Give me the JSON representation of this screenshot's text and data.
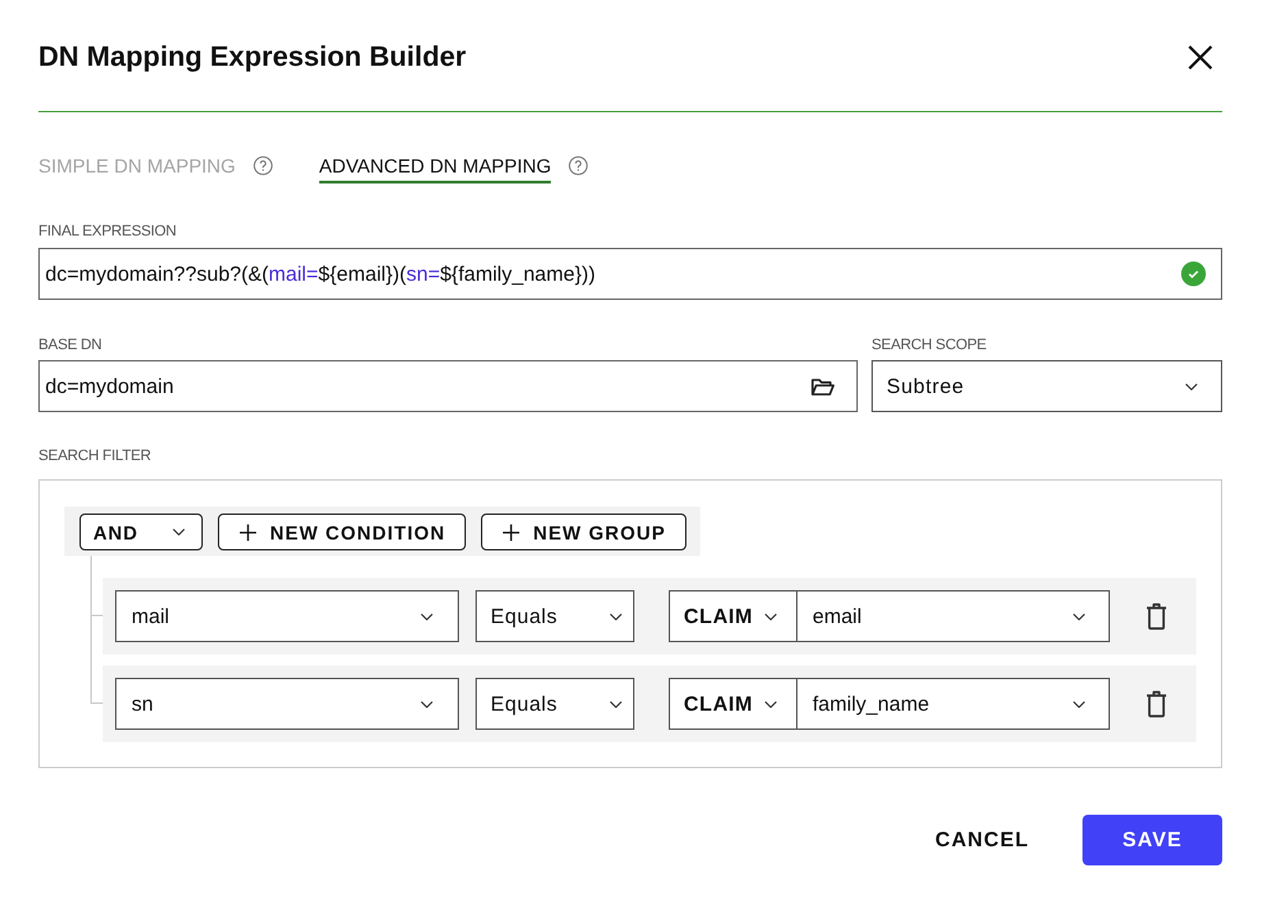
{
  "dialog": {
    "title": "DN Mapping Expression Builder"
  },
  "tabs": [
    {
      "label": "SIMPLE DN MAPPING",
      "selected": false
    },
    {
      "label": "ADVANCED DN MAPPING",
      "selected": true
    }
  ],
  "final_expression": {
    "label": "FINAL EXPRESSION",
    "segments": [
      {
        "text": "dc=mydomain??sub?(&(",
        "kind": "plain"
      },
      {
        "text": "mail=",
        "kind": "attribute"
      },
      {
        "text": "${email})(",
        "kind": "plain"
      },
      {
        "text": "sn=",
        "kind": "attribute"
      },
      {
        "text": "${family_name}))",
        "kind": "plain"
      }
    ],
    "valid": true
  },
  "base_dn": {
    "label": "BASE DN",
    "value": "dc=mydomain"
  },
  "search_scope": {
    "label": "SEARCH SCOPE",
    "value": "Subtree"
  },
  "search_filter": {
    "label": "SEARCH FILTER",
    "group": {
      "operator": "AND",
      "buttons": [
        "NEW CONDITION",
        "NEW GROUP"
      ]
    },
    "conditions": [
      {
        "attribute": "mail",
        "operator": "Equals",
        "value_type": "CLAIM",
        "value": "email"
      },
      {
        "attribute": "sn",
        "operator": "Equals",
        "value_type": "CLAIM",
        "value": "family_name"
      }
    ]
  },
  "footer": {
    "buttons": [
      {
        "label": "CANCEL",
        "kind": "text"
      },
      {
        "label": "SAVE",
        "kind": "primary"
      }
    ]
  }
}
